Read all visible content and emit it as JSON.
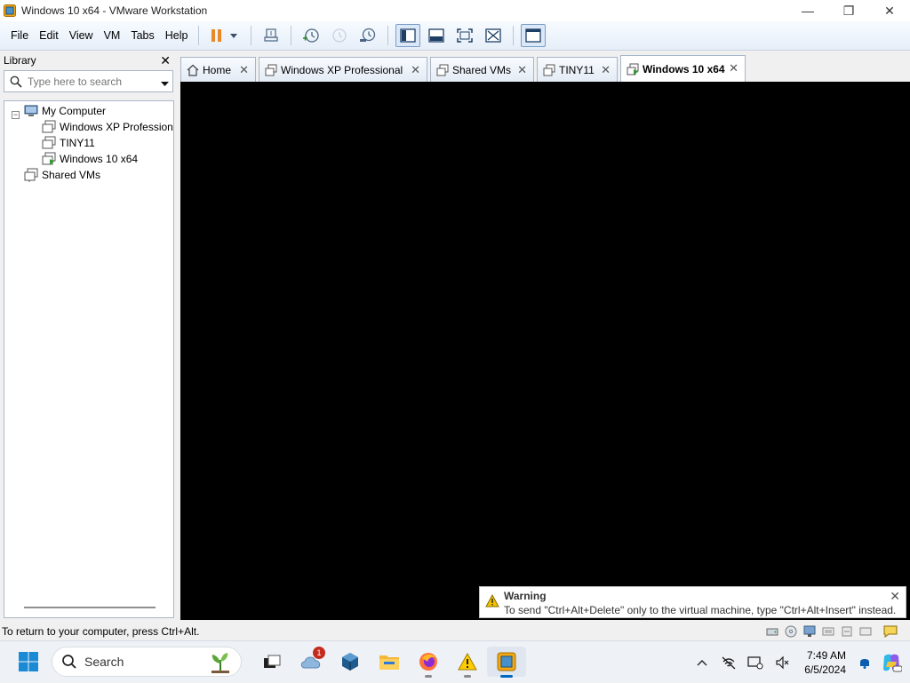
{
  "window": {
    "title": "Windows 10 x64 - VMware Workstation",
    "minimize": "—",
    "maximize": "❐",
    "close": "✕"
  },
  "menu": {
    "items": [
      "File",
      "Edit",
      "View",
      "VM",
      "Tabs",
      "Help"
    ]
  },
  "toolbar": {
    "buttons": [
      "pause-icon",
      "send-ctrl-alt-del-icon",
      "snapshot-take-icon",
      "snapshot-revert-icon",
      "snapshot-manager-icon",
      "show-library-icon",
      "thumbnail-bar-icon",
      "full-screen-icon",
      "unity-icon",
      "console-view-icon"
    ]
  },
  "library": {
    "title": "Library",
    "close": "✕",
    "search_placeholder": "Type here to search",
    "tree": {
      "root": "My Computer",
      "vms": [
        "Windows XP Professional",
        "TINY11",
        "Windows 10 x64"
      ],
      "shared": "Shared VMs"
    }
  },
  "tabs": [
    {
      "label": "Home",
      "icon": "home-icon"
    },
    {
      "label": "Windows XP Professional",
      "icon": "vm-icon"
    },
    {
      "label": "Shared VMs",
      "icon": "shared-vms-icon"
    },
    {
      "label": "TINY11",
      "icon": "vm-icon"
    },
    {
      "label": "Windows 10 x64",
      "icon": "vm-running-icon",
      "active": true
    }
  ],
  "tab_close": "✕",
  "warning": {
    "title": "Warning",
    "message": "To send \"Ctrl+Alt+Delete\" only to the virtual machine, type \"Ctrl+Alt+Insert\" instead.",
    "close": "✕"
  },
  "statusbar": {
    "text": "To return to your computer, press Ctrl+Alt."
  },
  "taskbar": {
    "search_label": "Search",
    "notification_count": "1",
    "time": "7:49 AM",
    "date": "6/5/2024"
  },
  "colors": {
    "accent": "#0067c0",
    "vm_screen": "#000000",
    "warning_icon": "#f2c200"
  }
}
